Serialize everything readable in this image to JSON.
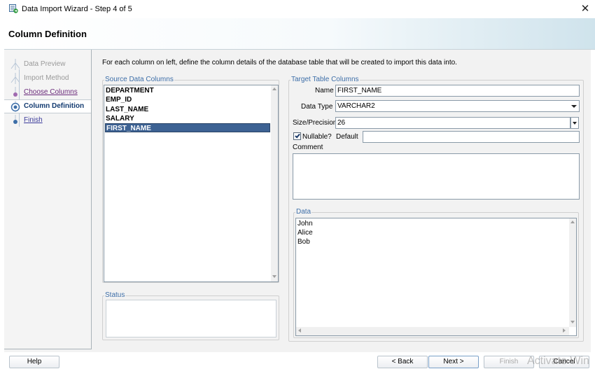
{
  "window": {
    "title": "Data Import Wizard - Step 4 of 5",
    "close_glyph": "✕"
  },
  "header": {
    "title": "Column Definition"
  },
  "nav": {
    "items": [
      {
        "label": "Data Preview",
        "state": "disabled"
      },
      {
        "label": "Import Method",
        "state": "disabled"
      },
      {
        "label": "Choose Columns",
        "state": "visited"
      },
      {
        "label": "Column Definition",
        "state": "current"
      },
      {
        "label": "Finish",
        "state": "link"
      }
    ]
  },
  "instructions": "For each column on left, define the column details of the database table that will be created to import this data into.",
  "source": {
    "title": "Source Data Columns",
    "columns": [
      "DEPARTMENT",
      "EMP_ID",
      "LAST_NAME",
      "SALARY",
      "FIRST_NAME"
    ],
    "selected_index": 4
  },
  "status": {
    "title": "Status"
  },
  "target": {
    "title": "Target Table Columns",
    "name_label": "Name",
    "name_value": "FIRST_NAME",
    "datatype_label": "Data Type",
    "datatype_value": "VARCHAR2",
    "size_label": "Size/Precision",
    "size_value": "26",
    "nullable_label": "Nullable?",
    "nullable_checked": true,
    "default_label": "Default",
    "default_value": "",
    "comment_label": "Comment",
    "comment_value": ""
  },
  "data": {
    "title": "Data",
    "rows": [
      "John",
      "Alice",
      "Bob"
    ]
  },
  "buttons": {
    "help": "Help",
    "back": "< Back",
    "next": "Next >",
    "finish": "Finish",
    "cancel": "Cancel"
  },
  "watermark": "Activate Win"
}
